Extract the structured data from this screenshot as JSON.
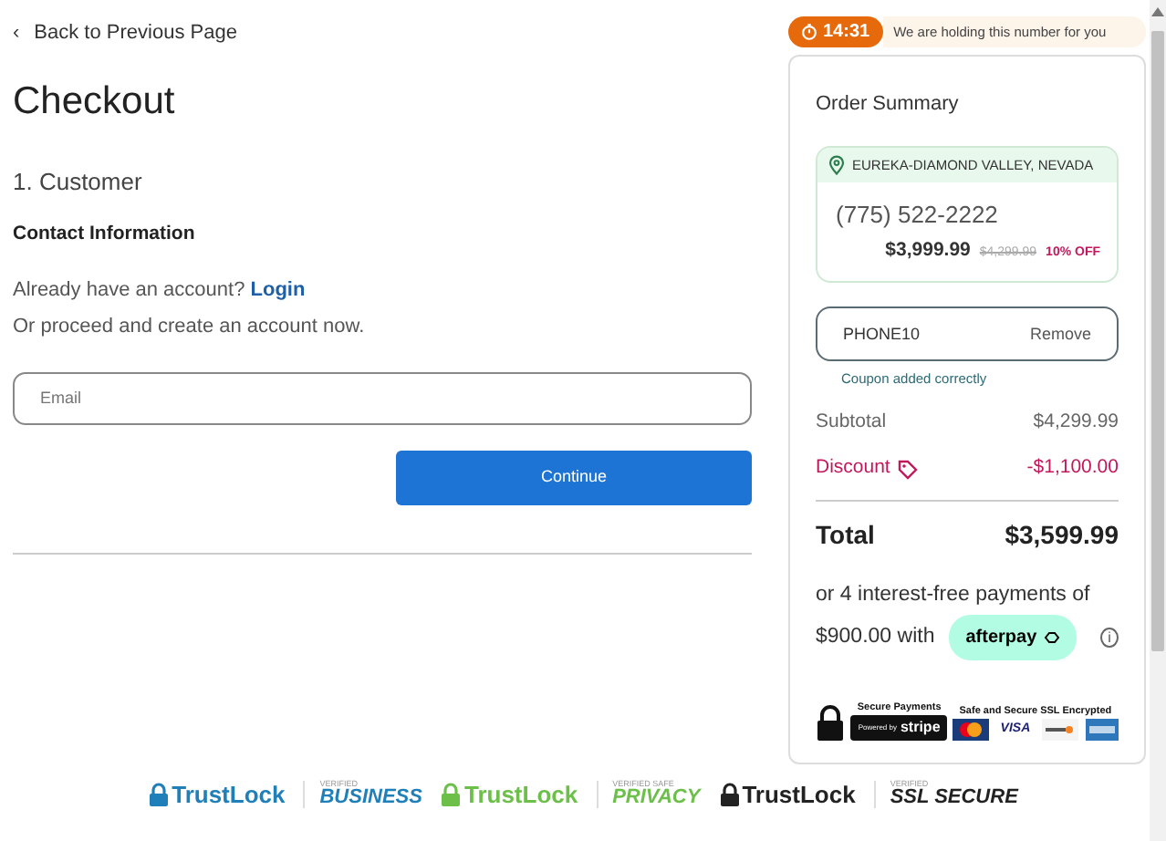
{
  "back_link": {
    "arrow": "‹",
    "label": "Back to Previous Page"
  },
  "title": "Checkout",
  "step": "1. Customer",
  "section": "Contact Information",
  "account": {
    "question": "Already have an account?",
    "login": "Login",
    "alternative": "Or proceed and create an account now."
  },
  "email": {
    "placeholder": "Email"
  },
  "continue_button": "Continue",
  "trust_badges": [
    {
      "kind": "lock",
      "text": "TrustLock",
      "color": "#1f7fb8"
    },
    {
      "kind": "verified",
      "small": "VERIFIED",
      "text": "BUSINESS",
      "color": "#1f7fb8"
    },
    {
      "kind": "lock",
      "text": "TrustLock",
      "color": "#6cc04a"
    },
    {
      "kind": "verified",
      "small": "VERIFIED SAFE",
      "text": "PRIVACY",
      "color": "#6cc04a"
    },
    {
      "kind": "lock",
      "text": "TrustLock",
      "color": "#222222"
    },
    {
      "kind": "verified",
      "small": "VERIFIED",
      "text": "SSL SECURE",
      "color": "#222222"
    }
  ],
  "timer": {
    "time": "14:31",
    "message": "We are holding this number for you"
  },
  "summary": {
    "title": "Order Summary",
    "number": {
      "location": "EUREKA-DIAMOND VALLEY, NEVADA",
      "phone": "(775) 522-2222",
      "price": "$3,999.99",
      "old_price": "$4,299.99",
      "discount": "10% OFF"
    },
    "coupon": {
      "code": "PHONE10",
      "action": "Remove",
      "note": "Coupon added correctly"
    },
    "lines": [
      {
        "kind": "plain",
        "label": "Subtotal",
        "value": "$4,299.99"
      },
      {
        "kind": "discount",
        "label": "Discount",
        "value": "-$1,100.00"
      }
    ],
    "total": {
      "label": "Total",
      "value": "$3,599.99"
    },
    "installments": {
      "line1": "or 4 interest-free payments of",
      "line2": "$900.00 with",
      "provider": "afterpay",
      "info": "i"
    },
    "security": {
      "payments_label": "Secure Payments",
      "powered": "Powered by",
      "stripe": "stripe",
      "ssl_label": "Safe and Secure SSL Encrypted",
      "visa": "VISA"
    }
  }
}
